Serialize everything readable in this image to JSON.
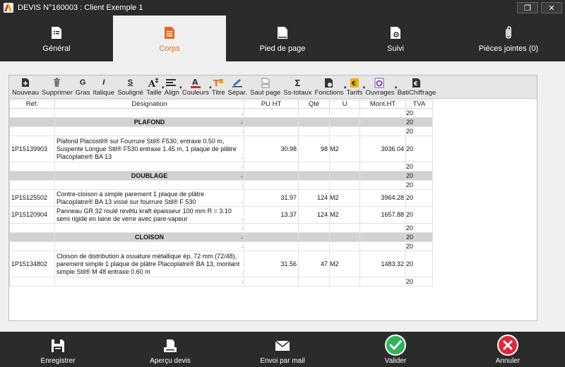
{
  "window": {
    "title": "DEVIS N°160003 : Client Exemple 1",
    "restore_symbol": "❐",
    "close_symbol": "✕"
  },
  "tabs": [
    {
      "label": "Général",
      "icon": "document-list-icon",
      "active": false
    },
    {
      "label": "Corps",
      "icon": "document-lines-icon",
      "active": true
    },
    {
      "label": "Pied de page",
      "icon": "document-blank-icon",
      "active": false
    },
    {
      "label": "Suivi",
      "icon": "document-gear-icon",
      "active": false
    },
    {
      "label": "Pièces jointes (0)",
      "icon": "paperclip-icon",
      "active": false
    }
  ],
  "toolbar": {
    "nouveau": "Nouveau",
    "supprimer": "Supprimer",
    "gras": "Gras",
    "gras_glyph": "G",
    "italique": "Italique",
    "italique_glyph": "I",
    "souligne": "Souligné",
    "souligne_glyph": "S",
    "taille": "Taille",
    "align": "Align",
    "couleurs": "Couleurs",
    "titre": "Titre",
    "separ": "Sépar.",
    "saut_page": "Saut page",
    "ss_totaux": "Ss-totaux",
    "ss_totaux_glyph": "Σ",
    "fonctions": "Fonctions",
    "tarifs": "Tarifs",
    "ouvrages": "Ouvrages",
    "batichiffrage": "BatiChiffrage"
  },
  "table": {
    "headers": {
      "ref": "Réf.",
      "designation": "Désignation",
      "pu": "PU HT",
      "qte": "Qté",
      "u": "U",
      "mont": "Mont.HT",
      "tva": "TVA"
    },
    "rows": [
      {
        "type": "normal",
        "ref": "",
        "desc": "",
        "pu": "",
        "qte": "",
        "u": "",
        "mont": "",
        "tva": "20"
      },
      {
        "type": "section",
        "ref": "",
        "desc": "PLAFOND",
        "pu": "",
        "qte": "",
        "u": "",
        "mont": "",
        "tva": "20"
      },
      {
        "type": "normal",
        "ref": "",
        "desc": "",
        "pu": "",
        "qte": "",
        "u": "",
        "mont": "",
        "tva": "20"
      },
      {
        "type": "normal",
        "ref": "1P15139903",
        "desc": "Plafond Placostil® sur Fourrure Stil® F530, entraxe 0.50 m, Suspente Longue Stil® F530 entraxe 1.45 m, 1 plaque de plâtre Placoplatre® BA 13",
        "pu": "30.98",
        "qte": "98",
        "u": "M2",
        "mont": "3036.04",
        "tva": "20"
      },
      {
        "type": "normal",
        "ref": "",
        "desc": "",
        "pu": "",
        "qte": "",
        "u": "",
        "mont": "",
        "tva": "20"
      },
      {
        "type": "section",
        "ref": "",
        "desc": "DOUBLAGE",
        "pu": "",
        "qte": "",
        "u": "",
        "mont": "",
        "tva": "20"
      },
      {
        "type": "normal",
        "ref": "",
        "desc": "",
        "pu": "",
        "qte": "",
        "u": "",
        "mont": "",
        "tva": "20"
      },
      {
        "type": "normal",
        "ref": "1P15125502",
        "desc": "Contre-cloison à simple parement 1 plaque de plâtre Placoplatre® BA 13 vissé sur fourrure Stil® F 530",
        "pu": "31.97",
        "qte": "124",
        "u": "M2",
        "mont": "3964.28",
        "tva": "20"
      },
      {
        "type": "normal",
        "ref": "1P15120904",
        "desc": "Panneau GR 32 roulé revêtu kraft épaisseur 100 mm R = 3.10 semi rigide en laine de verre avec pare-vapeur",
        "pu": "13.37",
        "qte": "124",
        "u": "M2",
        "mont": "1657.88",
        "tva": "20"
      },
      {
        "type": "normal",
        "ref": "",
        "desc": "",
        "pu": "",
        "qte": "",
        "u": "",
        "mont": "",
        "tva": "20"
      },
      {
        "type": "section",
        "ref": "",
        "desc": "CLOISON",
        "pu": "",
        "qte": "",
        "u": "",
        "mont": "",
        "tva": "20"
      },
      {
        "type": "normal",
        "ref": "",
        "desc": "",
        "pu": "",
        "qte": "",
        "u": "",
        "mont": "",
        "tva": "20"
      },
      {
        "type": "normal",
        "ref": "1P15134802",
        "desc": "Cloison de distribution à ossature métallique ép. 72 mm (72/48), parement simple 1 plaque de plâtre Placoplatre® BA 13, montant simple Stil® M 48 entraxe 0.60 m",
        "pu": "31.56",
        "qte": "47",
        "u": "M2",
        "mont": "1483.32",
        "tva": "20"
      },
      {
        "type": "normal",
        "ref": "",
        "desc": "",
        "pu": "",
        "qte": "",
        "u": "",
        "mont": "",
        "tva": "20"
      }
    ]
  },
  "footer": {
    "enregistrer": "Enregistrer",
    "apercu": "Aperçu devis",
    "mail": "Envoi par mail",
    "valider": "Valider",
    "annuler": "Annuler"
  },
  "colors": {
    "accent": "#e8691e",
    "valider": "#2fb457",
    "annuler": "#e0283a",
    "dark": "#2b2b2b"
  }
}
